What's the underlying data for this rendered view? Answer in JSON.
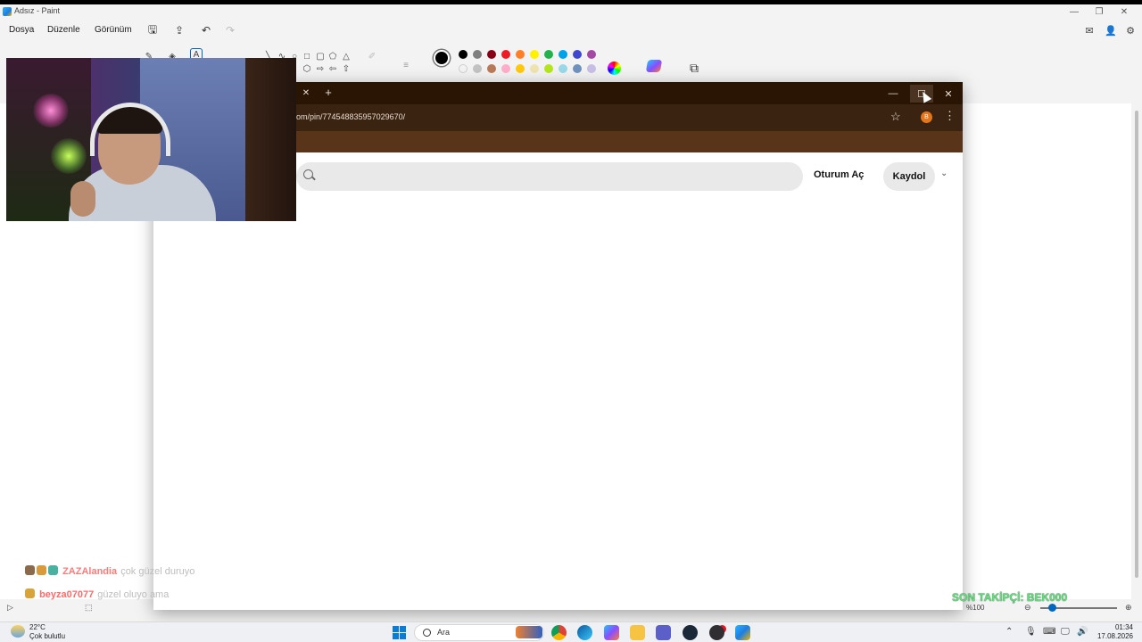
{
  "paint": {
    "title": "Adsız - Paint",
    "menu": [
      "Dosya",
      "Düzenle",
      "Görünüm"
    ],
    "zoom": "%100"
  },
  "palette": {
    "row1": [
      "#000000",
      "#7f7f7f",
      "#880015",
      "#ed1c24",
      "#ff7f27",
      "#fff200",
      "#22b14c",
      "#00a2e8",
      "#3f48cc",
      "#a349a4"
    ],
    "row2": [
      "#ffffff",
      "#c3c3c3",
      "#b97a57",
      "#ffaec9",
      "#ffc90e",
      "#efe4b0",
      "#b5e61d",
      "#99d9ea",
      "#7092be",
      "#c8bfe7"
    ],
    "active": "#000000"
  },
  "browser": {
    "url": "om/pin/774548835957029670/",
    "theme": "#2a1505",
    "extension_badge": "B"
  },
  "pinterest": {
    "login_label": "Oturum Aç",
    "signup_label": "Kaydol"
  },
  "chat": [
    {
      "user": "ZAZAlandia",
      "message": "çok güzel duruyo"
    },
    {
      "user": "beyza07077",
      "message": "güzel oluyo ama"
    }
  ],
  "overlay": {
    "last_follower": "SON TAKİPÇİ: BEK000"
  },
  "taskbar": {
    "temperature": "22°C",
    "weather": "Çok bulutlu",
    "search_placeholder": "Ara",
    "time": "01:34",
    "date": "17.08.2026"
  }
}
